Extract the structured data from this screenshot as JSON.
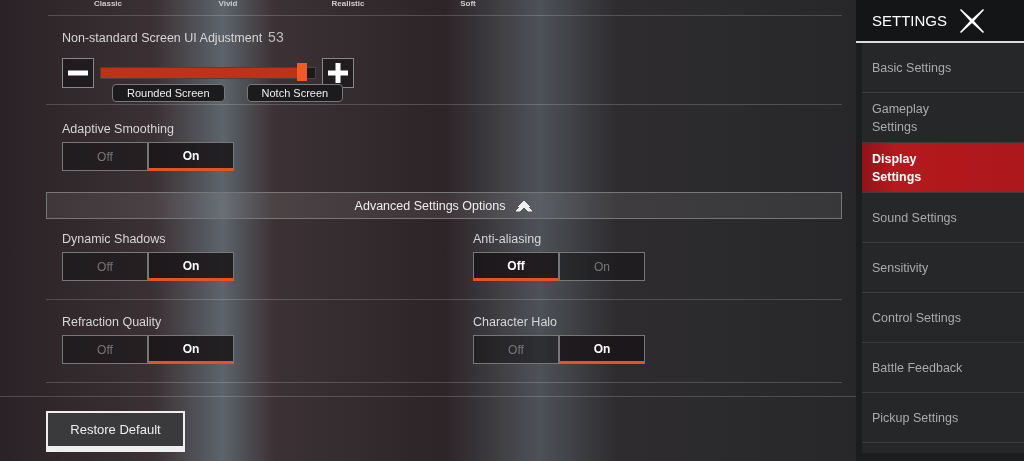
{
  "display_modes": [
    "Classic",
    "Vivid",
    "Realistic",
    "Soft"
  ],
  "screen_adjustment": {
    "label": "Non-standard Screen UI Adjustment",
    "value": "53",
    "level": 0.94,
    "markers": [
      "Rounded Screen",
      "Notch Screen"
    ]
  },
  "adaptive_smoothing": {
    "label": "Adaptive Smoothing",
    "options": [
      {
        "label": "Off",
        "selected": false
      },
      {
        "label": "On",
        "selected": true
      }
    ]
  },
  "advanced": {
    "title": "Advanced Settings Options",
    "expanded": true,
    "settings": [
      {
        "label": "Dynamic Shadows",
        "options": [
          {
            "label": "Off",
            "selected": false
          },
          {
            "label": "On",
            "selected": true
          }
        ]
      },
      {
        "label": "Anti-aliasing",
        "options": [
          {
            "label": "Off",
            "selected": true
          },
          {
            "label": "On",
            "selected": false
          }
        ]
      },
      {
        "label": "Refraction Quality",
        "options": [
          {
            "label": "Off",
            "selected": false
          },
          {
            "label": "On",
            "selected": true
          }
        ]
      },
      {
        "label": "Character Halo",
        "options": [
          {
            "label": "Off",
            "selected": false
          },
          {
            "label": "On",
            "selected": true
          }
        ]
      }
    ]
  },
  "restore_button": "Restore Default",
  "sidebar": {
    "title": "SETTINGS",
    "items": [
      {
        "label": "Basic Settings",
        "selected": false
      },
      {
        "label": "Gameplay Settings",
        "selected": false
      },
      {
        "label": "Display Settings",
        "selected": true
      },
      {
        "label": "Sound Settings",
        "selected": false
      },
      {
        "label": "Sensitivity",
        "selected": false
      },
      {
        "label": "Control Settings",
        "selected": false
      },
      {
        "label": "Battle Feedback",
        "selected": false
      },
      {
        "label": "Pickup Settings",
        "selected": false
      }
    ]
  }
}
